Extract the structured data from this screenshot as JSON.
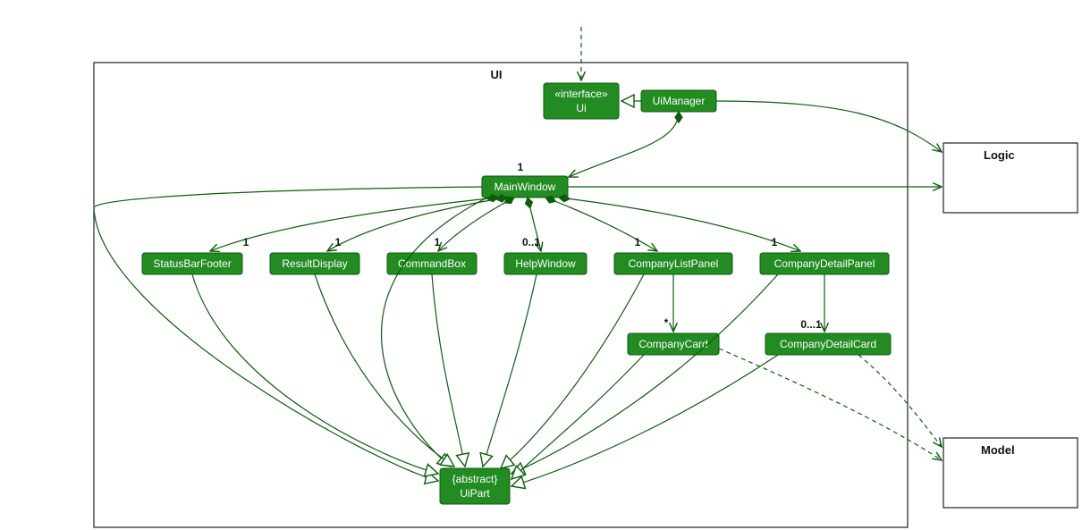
{
  "packages": {
    "ui": {
      "label": "UI"
    },
    "logic": {
      "label": "Logic"
    },
    "model": {
      "label": "Model"
    }
  },
  "classes": {
    "ui_if": {
      "stereotype": "«interface»",
      "name": "Ui"
    },
    "uimanager": {
      "name": "UiManager"
    },
    "mainwindow": {
      "name": "MainWindow"
    },
    "statusbarfooter": {
      "name": "StatusBarFooter"
    },
    "resultdisplay": {
      "name": "ResultDisplay"
    },
    "commandbox": {
      "name": "CommandBox"
    },
    "helpwindow": {
      "name": "HelpWindow"
    },
    "companylistpanel": {
      "name": "CompanyListPanel"
    },
    "companydetailpanel": {
      "name": "CompanyDetailPanel"
    },
    "companycard": {
      "name": "CompanyCard"
    },
    "companydetailcard": {
      "name": "CompanyDetailCard"
    },
    "uipart": {
      "stereotype": "{abstract}",
      "name": "UiPart"
    }
  },
  "multiplicities": {
    "mw": "1",
    "sbf": "1",
    "rd": "1",
    "cb": "1",
    "hw": "0..1",
    "clp": "1",
    "cdp": "1",
    "ccard": "*",
    "cdcard": "0...1"
  }
}
